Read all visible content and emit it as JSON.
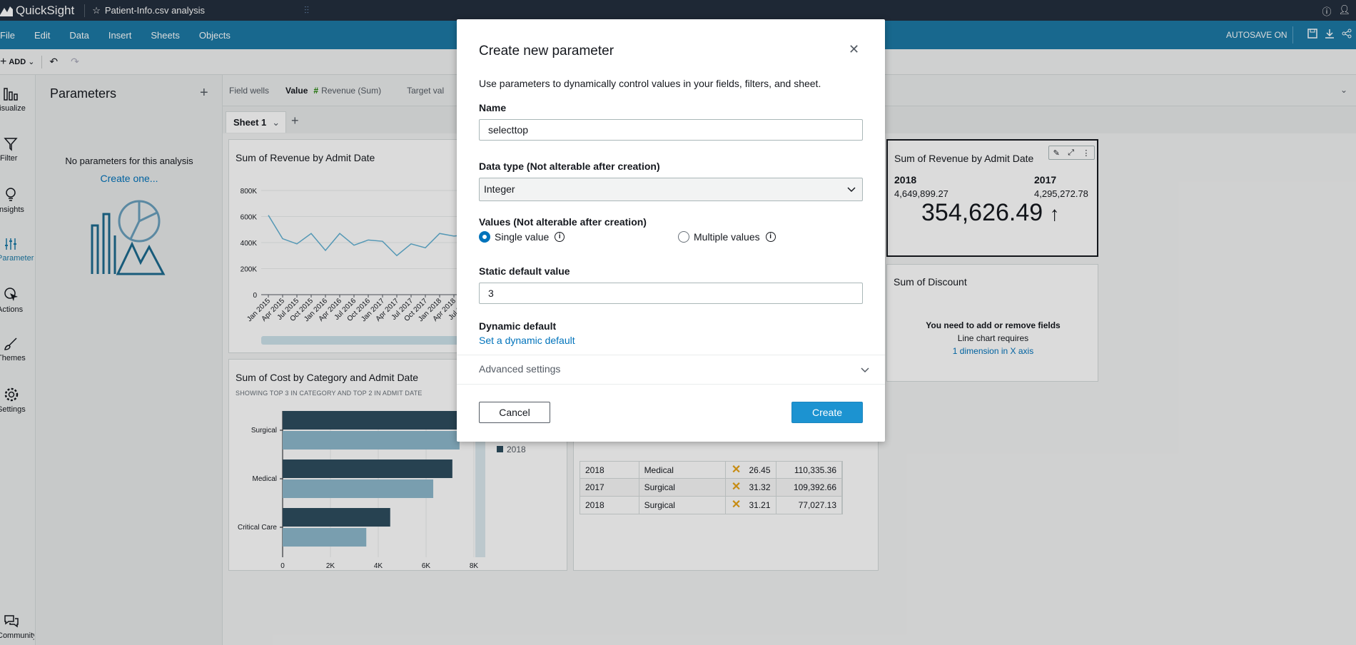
{
  "topbar": {
    "app_name": "QuickSight",
    "doc_title": "Patient-Info.csv analysis"
  },
  "menubar": {
    "items": [
      "File",
      "Edit",
      "Data",
      "Insert",
      "Sheets",
      "Objects"
    ],
    "autosave": "AUTOSAVE ON"
  },
  "toolbar": {
    "add_label": "ADD"
  },
  "rail": {
    "items": [
      {
        "label": "Visualize",
        "icon": "bar-chart-icon"
      },
      {
        "label": "Filter",
        "icon": "filter-icon"
      },
      {
        "label": "Insights",
        "icon": "lightbulb-icon"
      },
      {
        "label": "Parameters",
        "icon": "sliders-icon"
      },
      {
        "label": "Actions",
        "icon": "cursor-click-icon"
      },
      {
        "label": "Themes",
        "icon": "brush-icon"
      },
      {
        "label": "Settings",
        "icon": "gear-icon"
      },
      {
        "label": "Community",
        "icon": "chat-icon"
      }
    ]
  },
  "params_panel": {
    "title": "Parameters",
    "empty_text": "No parameters for this analysis",
    "create_link": "Create one..."
  },
  "fieldwells": {
    "label": "Field wells",
    "value_label": "Value",
    "value_field": "Revenue (Sum)",
    "target_label": "Target val"
  },
  "sheet": {
    "tab_label": "Sheet 1"
  },
  "visuals": {
    "line_chart": {
      "title": "Sum of Revenue by Admit Date",
      "y_ticks": [
        "800K",
        "600K",
        "400K",
        "200K",
        "0"
      ],
      "x_ticks": [
        "Jan 2015",
        "Apr 2015",
        "Jul 2015",
        "Oct 2015",
        "Jan 2016",
        "Apr 2016",
        "Jul 2016",
        "Oct 2016",
        "Jan 2017",
        "Apr 2017",
        "Jul 2017",
        "Oct 2017",
        "Jan 2018",
        "Apr 2018",
        "Jul 2018"
      ]
    },
    "bar_chart": {
      "title": "Sum of Cost by Category and Admit Date",
      "subtitle": "SHOWING TOP 3 IN CATEGORY AND TOP 2 IN ADMIT DATE",
      "categories": [
        "Surgical",
        "Medical",
        "Critical Care"
      ],
      "x_ticks": [
        "0",
        "2K",
        "4K",
        "6K",
        "8K"
      ],
      "legend_item": "2018"
    },
    "kpi": {
      "title": "Sum of Revenue by Admit Date",
      "year_a": "2018",
      "value_a": "4,649,899.27",
      "year_b": "2017",
      "value_b": "4,295,272.78",
      "big_value": "354,626.49",
      "arrow": "↑"
    },
    "discount": {
      "title": "Sum of Discount",
      "msg1": "You need to add or remove fields",
      "msg2": "Line chart requires",
      "msg3": "1 dimension in X axis"
    },
    "table": {
      "rows": [
        {
          "year": "2018",
          "category": "Medical",
          "score": "26.45",
          "value": "110,335.36"
        },
        {
          "year": "2017",
          "category": "Surgical",
          "score": "31.32",
          "value": "109,392.66"
        },
        {
          "year": "2018",
          "category": "Surgical",
          "score": "31.21",
          "value": "77,027.13"
        }
      ]
    }
  },
  "chart_data": [
    {
      "type": "line",
      "title": "Sum of Revenue by Admit Date",
      "x": [
        "Jan 2015",
        "Apr 2015",
        "Jul 2015",
        "Oct 2015",
        "Jan 2016",
        "Apr 2016",
        "Jul 2016",
        "Oct 2016",
        "Jan 2017",
        "Apr 2017",
        "Jul 2017",
        "Oct 2017",
        "Jan 2018",
        "Apr 2018",
        "Jul 2018"
      ],
      "values": [
        610000,
        430000,
        390000,
        470000,
        340000,
        470000,
        380000,
        420000,
        410000,
        300000,
        390000,
        360000,
        470000,
        450000,
        460000
      ],
      "ylim": [
        0,
        800000
      ]
    },
    {
      "type": "bar",
      "title": "Sum of Cost by Category and Admit Date",
      "categories": [
        "Surgical",
        "Medical",
        "Critical Care"
      ],
      "series": [
        {
          "values": [
            7700,
            7100,
            4500
          ]
        },
        {
          "name": "2018",
          "values": [
            7400,
            6300,
            3500
          ]
        }
      ],
      "xlim": [
        0,
        8000
      ]
    }
  ],
  "modal": {
    "title": "Create new parameter",
    "description": "Use parameters to dynamically control values in your fields, filters, and sheet.",
    "name_label": "Name",
    "name_value": "selecttop",
    "datatype_label": "Data type (Not alterable after creation)",
    "datatype_value": "Integer",
    "values_label": "Values (Not alterable after creation)",
    "single_value": "Single value",
    "multiple_values": "Multiple values",
    "static_default_label": "Static default value",
    "static_default_value": "3",
    "dynamic_default_label": "Dynamic default",
    "dynamic_default_link": "Set a dynamic default",
    "advanced_label": "Advanced settings",
    "cancel_label": "Cancel",
    "create_label": "Create"
  }
}
